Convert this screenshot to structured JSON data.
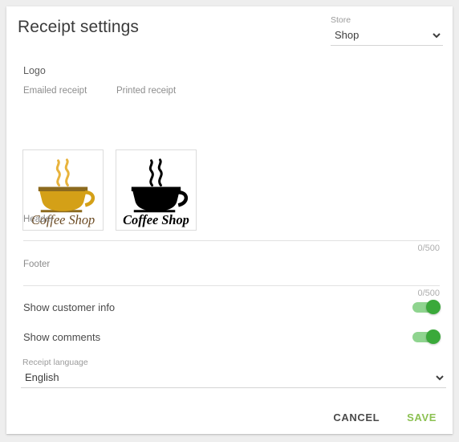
{
  "window": {
    "background_color": "#eeeeee",
    "card_background": "#ffffff"
  },
  "header": {
    "title": "Receipt settings",
    "store_field": {
      "label": "Store",
      "value": "Shop",
      "options": [
        "Shop"
      ],
      "icon": "chevron-down-icon"
    }
  },
  "logo_section": {
    "heading": "Logo",
    "emailed": {
      "label": "Emailed receipt",
      "caption": "Coffee Shop",
      "cup_color": "#d4a017",
      "rim_color": "#8c6a1e",
      "steam_color": "#e8b33c",
      "caption_color": "#6b4a23"
    },
    "printed": {
      "label": "Printed receipt",
      "caption": "Coffee Shop",
      "cup_color": "#000000",
      "rim_color": "#000000",
      "steam_color": "#000000",
      "caption_color": "#000000"
    }
  },
  "fields": {
    "header": {
      "label": "Header",
      "value": "",
      "placeholder": "",
      "counter": "0/500"
    },
    "footer": {
      "label": "Footer",
      "value": "",
      "placeholder": "",
      "counter": "0/500"
    }
  },
  "toggles": [
    {
      "label": "Show customer info",
      "state": "on",
      "color": "#3aa93a"
    },
    {
      "label": "Show comments",
      "state": "on",
      "color": "#3aa93a"
    }
  ],
  "language_field": {
    "label": "Receipt language",
    "value": "English",
    "options": [
      "English"
    ],
    "icon": "chevron-down-icon"
  },
  "actions": {
    "cancel_label": "CANCEL",
    "save_label": "SAVE",
    "save_color": "#8cc152",
    "cancel_color": "#4a4a4a"
  }
}
